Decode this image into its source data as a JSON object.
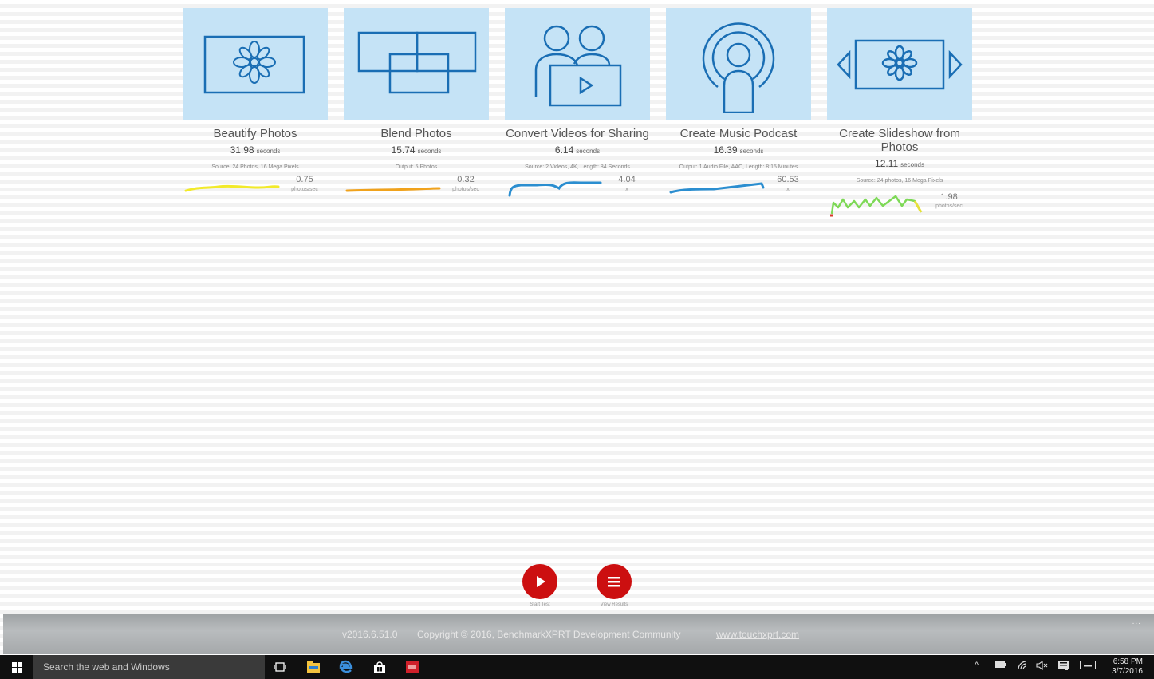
{
  "cards": [
    {
      "title": "Beautify Photos",
      "time": "31.98",
      "time_unit": "seconds",
      "detail": "Source: 24 Photos, 16 Mega Pixels",
      "metric": "0.75",
      "metric_unit": "photos/sec",
      "spark_color": "#f2ea2a"
    },
    {
      "title": "Blend Photos",
      "time": "15.74",
      "time_unit": "seconds",
      "detail": "Output: 5 Photos",
      "metric": "0.32",
      "metric_unit": "photos/sec",
      "spark_color": "#f0a21c"
    },
    {
      "title": "Convert Videos for Sharing",
      "time": "6.14",
      "time_unit": "seconds",
      "detail": "Source: 2 Videos, 4K, Length: 84 Seconds",
      "metric": "4.04",
      "metric_unit": "x",
      "spark_color": "#2b8ed0"
    },
    {
      "title": "Create Music Podcast",
      "time": "16.39",
      "time_unit": "seconds",
      "detail": "Output: 1 Audio File, AAC, Length: 8:15 Minutes",
      "metric": "60.53",
      "metric_unit": "x",
      "spark_color": "#2b8ed0"
    },
    {
      "title": "Create Slideshow from Photos",
      "time": "12.11",
      "time_unit": "seconds",
      "detail": "Source: 24 photos, 16 Mega Pixels",
      "metric": "1.98",
      "metric_unit": "photos/sec",
      "spark_color": "#7ed957"
    }
  ],
  "controls": {
    "start_label": "Start Test",
    "results_label": "View Results"
  },
  "footer": {
    "version": "v2016.6.51.0",
    "copyright": "Copyright © 2016, BenchmarkXPRT Development Community",
    "link": "www.touchxprt.com",
    "more": "..."
  },
  "taskbar": {
    "search_placeholder": "Search the web and Windows",
    "time": "6:58 PM",
    "date": "3/7/2016"
  },
  "colors": {
    "tile_bg": "#c5e3f6",
    "icon_stroke": "#1a6eb4",
    "accent_red": "#cc0f10"
  }
}
